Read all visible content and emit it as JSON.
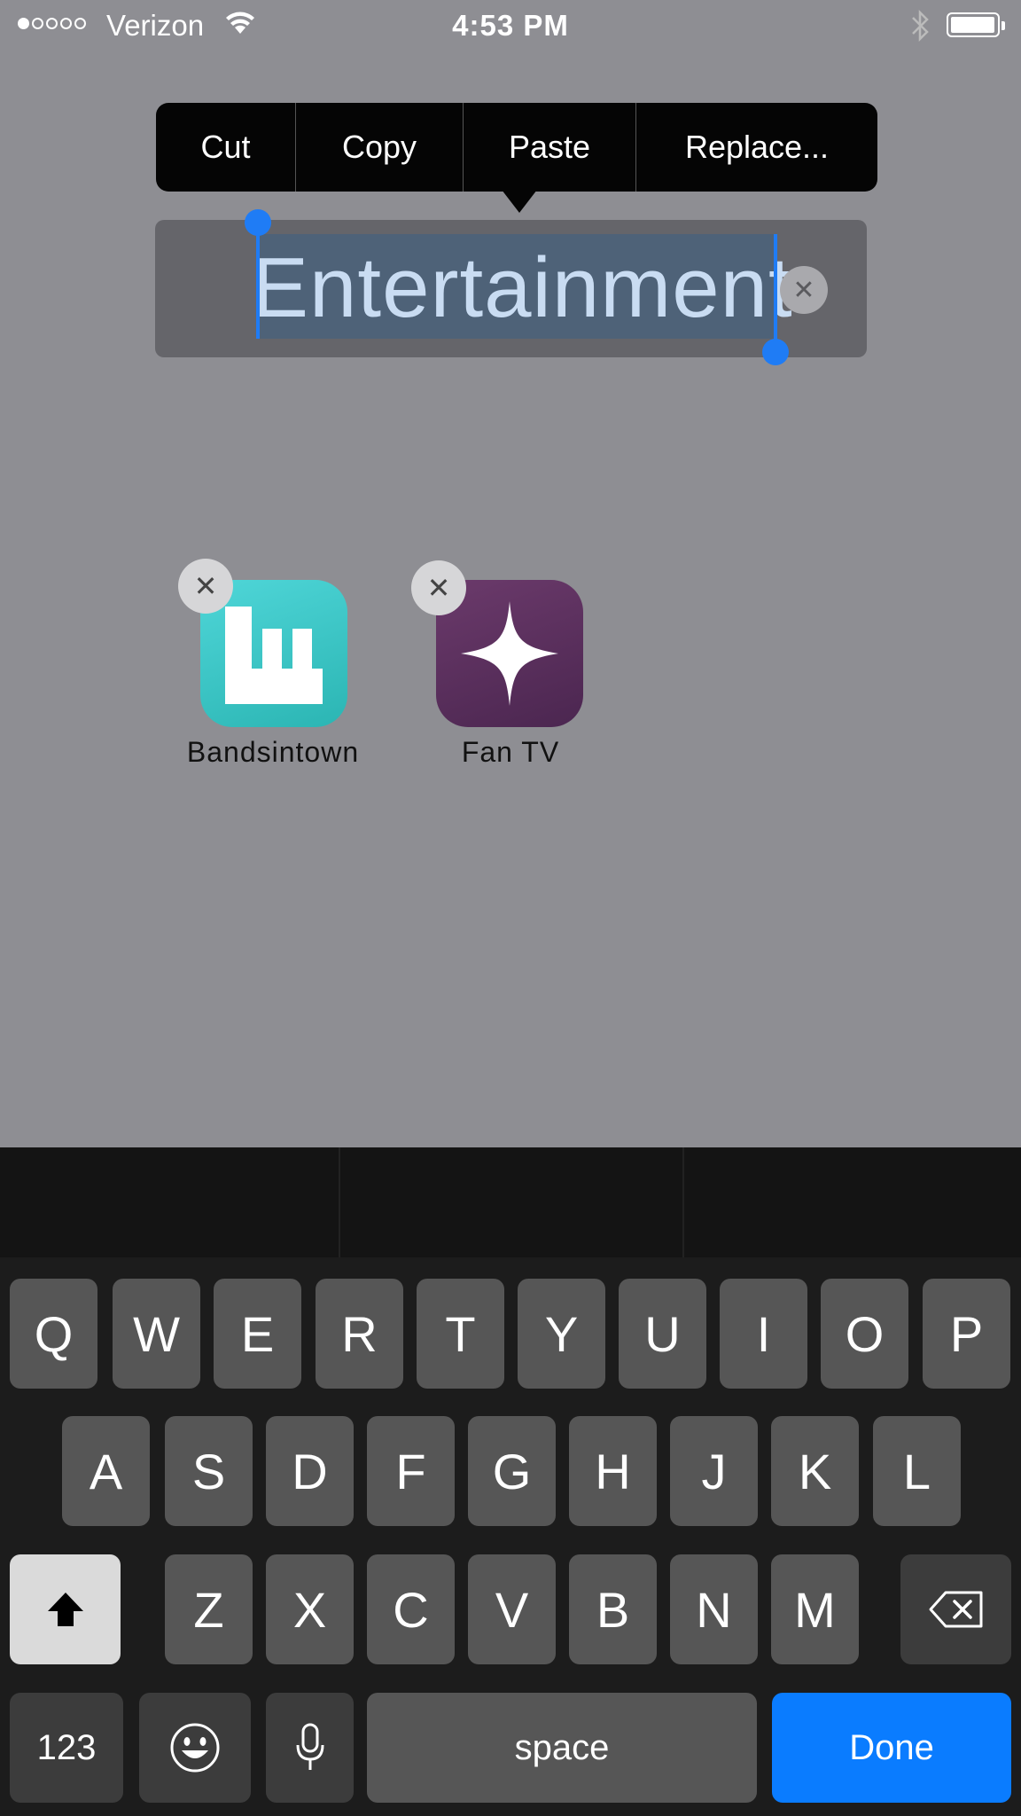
{
  "status_bar": {
    "carrier": "Verizon",
    "time": "4:53 PM",
    "signal_bars_filled": 1,
    "signal_bars_total": 5,
    "icons": [
      "wifi-icon",
      "bluetooth-icon",
      "battery-icon"
    ]
  },
  "edit_menu": {
    "items": [
      "Cut",
      "Copy",
      "Paste",
      "Replace..."
    ]
  },
  "folder": {
    "name": "Entertainment",
    "name_selected": true
  },
  "apps": [
    {
      "label": "Bandsintown",
      "icon": "bandsintown-icon",
      "color": "#3fc9c9"
    },
    {
      "label": "Fan TV",
      "icon": "fan-tv-sparkle-icon",
      "color": "#5a2f5c"
    }
  ],
  "keyboard": {
    "row1": [
      "Q",
      "W",
      "E",
      "R",
      "T",
      "Y",
      "U",
      "I",
      "O",
      "P"
    ],
    "row2": [
      "A",
      "S",
      "D",
      "F",
      "G",
      "H",
      "J",
      "K",
      "L"
    ],
    "row3": [
      "Z",
      "X",
      "C",
      "V",
      "B",
      "N",
      "M"
    ],
    "numbers_label": "123",
    "space_label": "space",
    "done_label": "Done",
    "icons": [
      "shift-icon",
      "backspace-icon",
      "emoji-icon",
      "microphone-icon"
    ]
  },
  "colors": {
    "selection_handle": "#1f7cf5",
    "done_button": "#0a7cff",
    "wallpaper_dim": "#8e8e93"
  }
}
